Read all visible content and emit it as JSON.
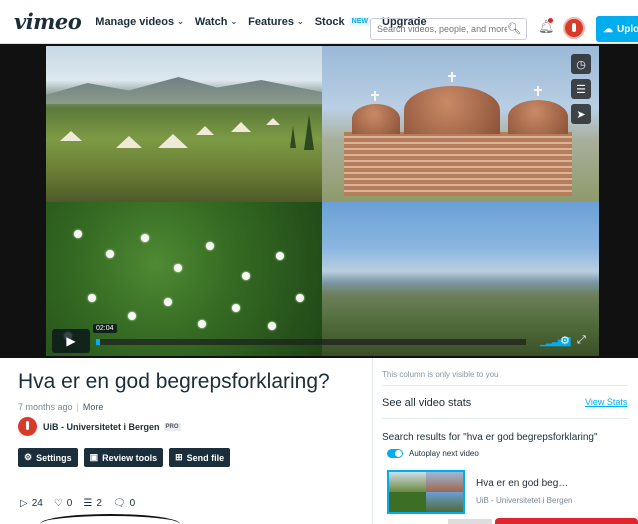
{
  "nav": {
    "logo": "vimeo",
    "items": [
      {
        "label": "Manage videos",
        "chevron": true
      },
      {
        "label": "Watch",
        "chevron": true
      },
      {
        "label": "Features",
        "chevron": true
      },
      {
        "label": "Stock",
        "badge": "NEW"
      },
      {
        "label": "Upgrade"
      }
    ],
    "search_placeholder": "Search videos, people, and more",
    "upload_label": "Uplo"
  },
  "player": {
    "timecode": "02:04",
    "progress": 0.01
  },
  "video": {
    "title": "Hva er en god begrepsforklaring?",
    "age": "7 months ago",
    "more": "More",
    "owner": "UiB - Universitetet i Bergen",
    "owner_badge": "PRO",
    "actions": [
      "Settings",
      "Review tools",
      "Send file"
    ],
    "stats": {
      "plays": "24",
      "likes": "0",
      "collections": "2",
      "comments": "0"
    }
  },
  "sidebar": {
    "note": "This column is only visible to you",
    "all_stats": "See all video stats",
    "view_stats": "View Stats",
    "results_heading": "Search results for \"hva er god begrepsforklaring\"",
    "autoplay_label": "Autoplay next video",
    "next_title": "Hva er en god beg…",
    "next_owner": "UiB - Universitetet i Bergen"
  },
  "colors": {
    "brand": "#00adef",
    "navy": "#1a2e3b",
    "notification": "#e0252f"
  }
}
